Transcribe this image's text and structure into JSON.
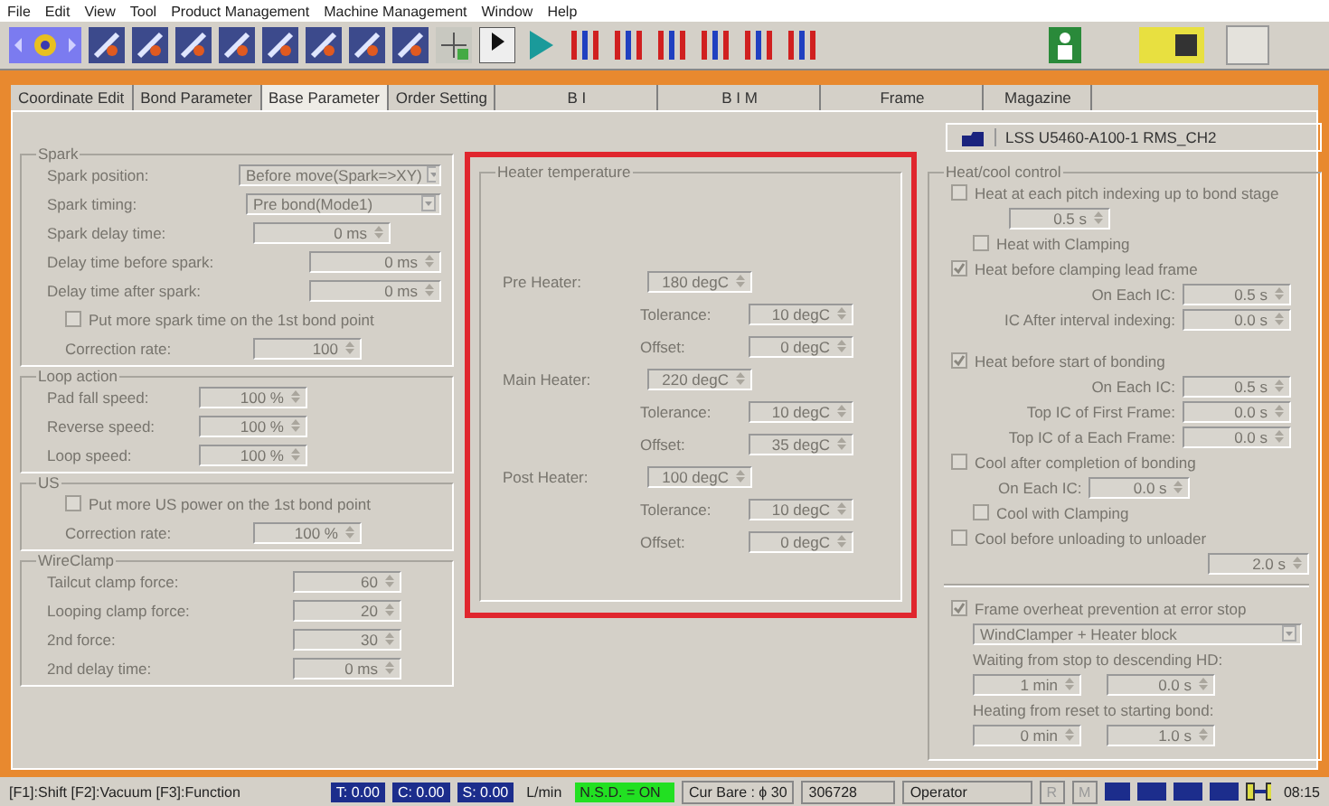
{
  "menu": [
    "File",
    "Edit",
    "View",
    "Tool",
    "Product Management",
    "Machine Management",
    "Window",
    "Help"
  ],
  "tabs": [
    {
      "label": "Coordinate Edit",
      "selected": false
    },
    {
      "label": "Bond Parameter",
      "selected": false
    },
    {
      "label": "Base Parameter",
      "selected": true
    },
    {
      "label": "Order Setting",
      "selected": false
    },
    {
      "label": "B I",
      "selected": false
    },
    {
      "label": "B I M",
      "selected": false
    },
    {
      "label": "Frame",
      "selected": false
    },
    {
      "label": "Magazine",
      "selected": false
    }
  ],
  "left_groups": [
    {
      "title": "Spark",
      "rows": [
        {
          "kind": "select",
          "label": "Spark position:",
          "value": "Before move(Spark=>XY)"
        },
        {
          "kind": "select",
          "label": "Spark timing:",
          "value": "Pre bond(Mode1)"
        },
        {
          "kind": "spin",
          "label": "Spark delay time:",
          "value": "0 ms"
        },
        {
          "kind": "spin_far",
          "label": "Delay time before spark:",
          "value": "0 ms"
        },
        {
          "kind": "spin_far",
          "label": "Delay time after spark:",
          "value": "0 ms"
        },
        {
          "kind": "check",
          "label": "Put more spark time on the 1st bond point",
          "checked": false
        },
        {
          "kind": "spin_sub",
          "label": "Correction rate:",
          "value": "100"
        }
      ]
    },
    {
      "title": "Loop action",
      "rows": [
        {
          "kind": "spin_near",
          "label": "Pad fall speed:",
          "value": "100 %"
        },
        {
          "kind": "spin_near",
          "label": "Reverse speed:",
          "value": "100 %"
        },
        {
          "kind": "spin_near",
          "label": "Loop speed:",
          "value": "100 %"
        }
      ]
    },
    {
      "title": "US",
      "rows": [
        {
          "kind": "check",
          "label": "Put more US power on the 1st bond point",
          "checked": false
        },
        {
          "kind": "spin_sub",
          "label": "Correction rate:",
          "value": "100 %"
        }
      ]
    },
    {
      "title": "WireClamp",
      "rows": [
        {
          "kind": "spin_mid",
          "label": "Tailcut clamp force:",
          "value": "60"
        },
        {
          "kind": "spin_mid",
          "label": "Looping clamp force:",
          "value": "20"
        },
        {
          "kind": "spin_mid",
          "label": "2nd force:",
          "value": "30"
        },
        {
          "kind": "spin_mid",
          "label": "2nd delay time:",
          "value": "0 ms"
        }
      ]
    }
  ],
  "heater_temperature": {
    "title": "Heater temperature",
    "heaters": [
      {
        "name": "Pre Heater:",
        "value": "180 degC",
        "tolerance_label": "Tolerance:",
        "tolerance": "10 degC",
        "offset_label": "Offset:",
        "offset": "0 degC"
      },
      {
        "name": "Main Heater:",
        "value": "220 degC",
        "tolerance_label": "Tolerance:",
        "tolerance": "10 degC",
        "offset_label": "Offset:",
        "offset": "35 degC"
      },
      {
        "name": "Post Heater:",
        "value": "100 degC",
        "tolerance_label": "Tolerance:",
        "tolerance": "10 degC",
        "offset_label": "Offset:",
        "offset": "0 degC"
      }
    ]
  },
  "device_name": "LSS U5460-A100-1 RMS_CH2",
  "heat_cool_control": {
    "title": "Heat/cool control",
    "items": [
      {
        "kind": "check",
        "label": "Heat at each pitch indexing up to bond stage",
        "checked": false,
        "children": [
          {
            "kind": "spin",
            "value": "0.5 s"
          },
          {
            "kind": "check",
            "label": "Heat with Clamping",
            "checked": false
          }
        ]
      },
      {
        "kind": "check",
        "label": "Heat before clamping lead frame",
        "checked": true,
        "children": [
          {
            "kind": "labeled",
            "label": "On Each IC:",
            "value": "0.5 s"
          },
          {
            "kind": "labeled",
            "label": "IC After interval indexing:",
            "value": "0.0 s"
          }
        ]
      },
      {
        "kind": "check",
        "label": "Heat before start of bonding",
        "checked": true,
        "children": [
          {
            "kind": "labeled",
            "label": "On Each IC:",
            "value": "0.5 s"
          },
          {
            "kind": "labeled",
            "label": "Top IC of First Frame:",
            "value": "0.0 s"
          },
          {
            "kind": "labeled",
            "label": "Top IC of a Each Frame:",
            "value": "0.0 s"
          }
        ]
      },
      {
        "kind": "check",
        "label": "Cool after completion of bonding",
        "checked": false,
        "children": [
          {
            "kind": "inline",
            "label": "On Each IC:",
            "value": "0.0 s"
          },
          {
            "kind": "check",
            "label": "Cool with Clamping",
            "checked": false
          }
        ]
      },
      {
        "kind": "check",
        "label": "Cool before unloading to unloader",
        "checked": false,
        "children": [
          {
            "kind": "spin",
            "value": "2.0 s"
          }
        ]
      }
    ],
    "overheat": {
      "label": "Frame overheat prevention at error stop",
      "checked": true,
      "select": "WindClamper + Heater block",
      "waiting_label": "Waiting from stop to descending HD:",
      "waiting": [
        "1 min",
        "0.0 s"
      ],
      "heating_label": "Heating from reset to starting bond:",
      "heating": [
        "0 min",
        "1.0 s"
      ]
    }
  },
  "status_bar": {
    "keys": "[F1]:Shift [F2]:Vacuum [F3]:Function",
    "readings": [
      "T: 0.00",
      "C: 0.00",
      "S: 0.00"
    ],
    "unit": "L/min",
    "nsd": "N.S.D. = ON",
    "bare": "Cur Bare : ϕ 30",
    "count": "306728",
    "user": "Operator",
    "flags": [
      "R",
      "M"
    ],
    "time": "08:15"
  }
}
